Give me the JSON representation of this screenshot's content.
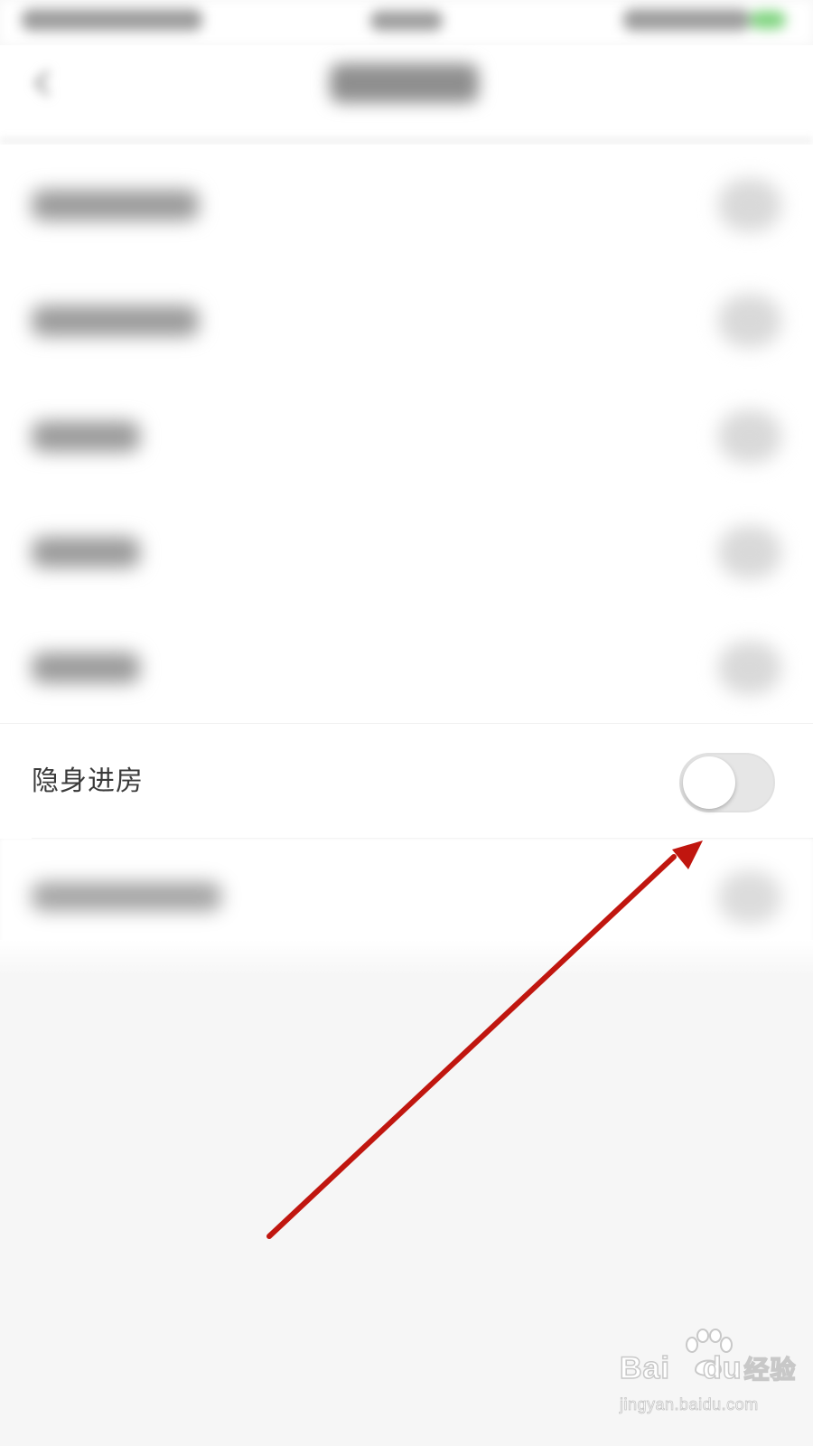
{
  "settings": {
    "rows": [
      {
        "label": "隐身进房",
        "toggle_on": false
      }
    ]
  },
  "annotation": {
    "type": "arrow",
    "color": "#c0160f"
  },
  "watermark": {
    "logo_left": "Bai",
    "logo_right": "du",
    "logo_cn": "经验",
    "url": "jingyan.baidu.com"
  }
}
